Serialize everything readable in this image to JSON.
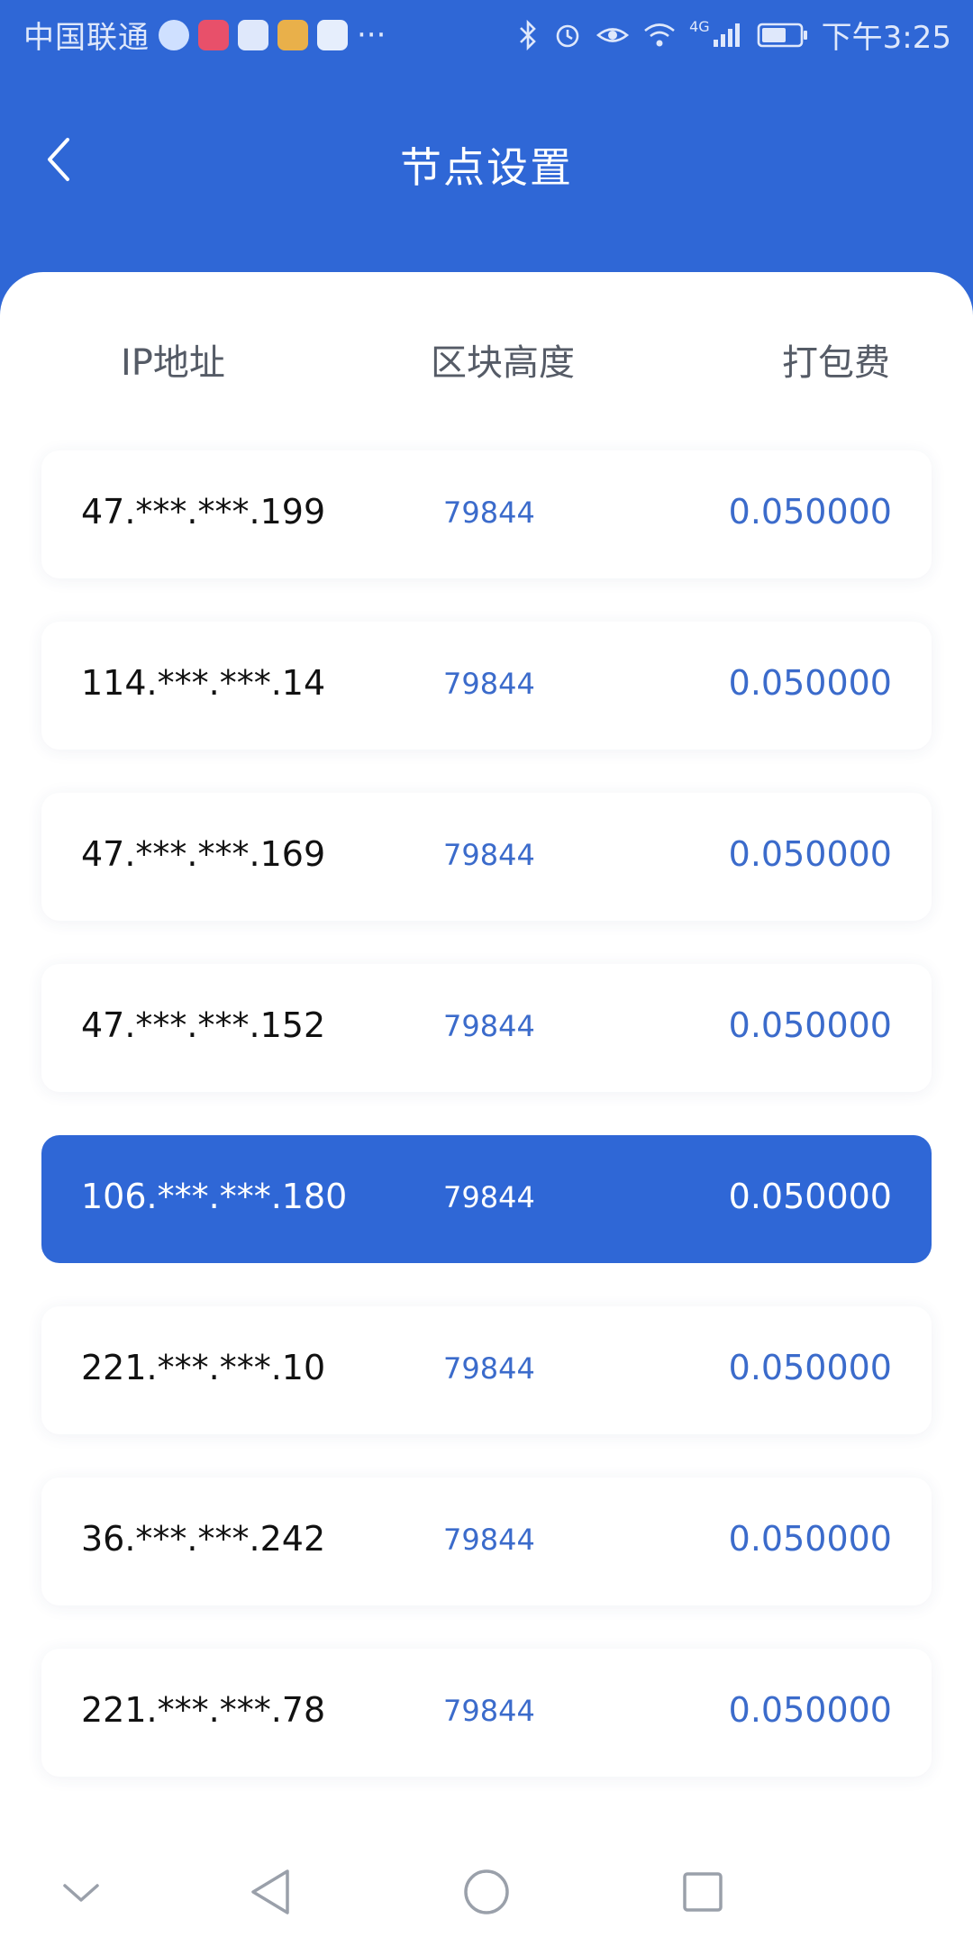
{
  "status_bar": {
    "carrier": "中国联通",
    "more": "···",
    "network": "4G",
    "time": "下午3:25"
  },
  "header": {
    "title": "节点设置",
    "back_icon": "chevron-left-icon"
  },
  "table": {
    "columns": [
      "IP地址",
      "区块高度",
      "打包费"
    ],
    "rows": [
      {
        "ip": "47.***.***.199",
        "height": "79844",
        "fee": "0.050000",
        "selected": false
      },
      {
        "ip": "114.***.***.14",
        "height": "79844",
        "fee": "0.050000",
        "selected": false
      },
      {
        "ip": "47.***.***.169",
        "height": "79844",
        "fee": "0.050000",
        "selected": false
      },
      {
        "ip": "47.***.***.152",
        "height": "79844",
        "fee": "0.050000",
        "selected": false
      },
      {
        "ip": "106.***.***.180",
        "height": "79844",
        "fee": "0.050000",
        "selected": true
      },
      {
        "ip": "221.***.***.10",
        "height": "79844",
        "fee": "0.050000",
        "selected": false
      },
      {
        "ip": "36.***.***.242",
        "height": "79844",
        "fee": "0.050000",
        "selected": false
      },
      {
        "ip": "221.***.***.78",
        "height": "79844",
        "fee": "0.050000",
        "selected": false
      }
    ]
  },
  "colors": {
    "primary": "#2f67d6",
    "value_blue": "#3b6bcb",
    "background": "#ffffff"
  },
  "nav_bar": {
    "icons": [
      "chevron-down-icon",
      "back-triangle-icon",
      "home-circle-icon",
      "recents-square-icon"
    ]
  }
}
